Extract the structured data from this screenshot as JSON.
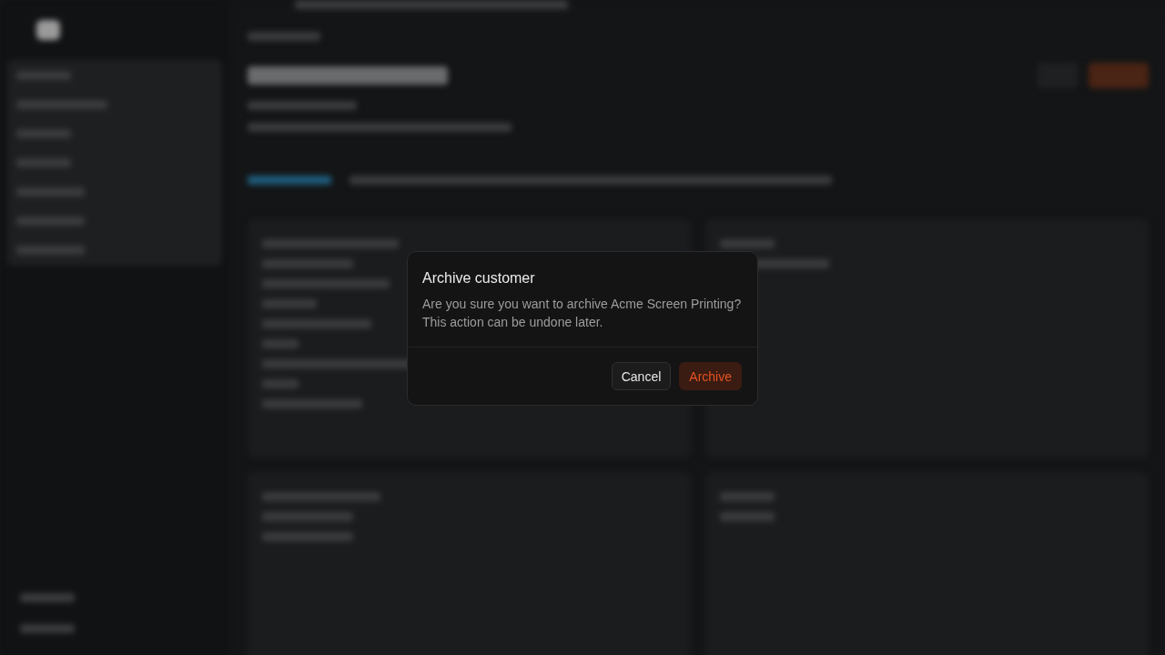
{
  "dialog": {
    "title": "Archive customer",
    "message": "Are you sure you want to archive Acme Screen Printing? This action can be undone later.",
    "buttons": [
      {
        "label": "Cancel",
        "kind": "secondary"
      },
      {
        "label": "Archive",
        "kind": "danger"
      }
    ]
  }
}
